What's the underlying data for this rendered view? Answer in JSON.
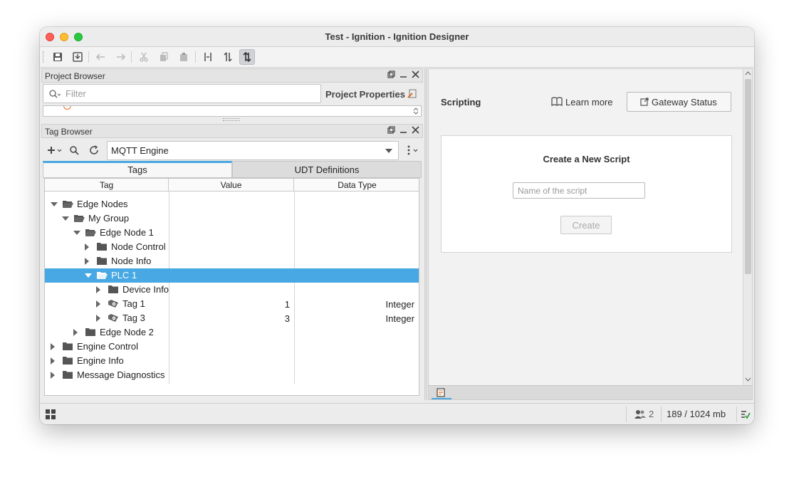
{
  "window": {
    "title": "Test - Ignition - Ignition Designer"
  },
  "project_browser": {
    "title": "Project Browser",
    "filter_placeholder": "Filter",
    "properties_label": "Project Properties"
  },
  "tag_browser": {
    "title": "Tag Browser",
    "provider": "MQTT Engine",
    "tabs": [
      "Tags",
      "UDT Definitions"
    ],
    "columns": [
      "Tag",
      "Value",
      "Data Type"
    ],
    "rows": [
      {
        "label": "Edge Nodes",
        "value": "",
        "type": ""
      },
      {
        "label": "My Group",
        "value": "",
        "type": ""
      },
      {
        "label": "Edge Node 1",
        "value": "",
        "type": ""
      },
      {
        "label": "Node Control",
        "value": "",
        "type": ""
      },
      {
        "label": "Node Info",
        "value": "",
        "type": ""
      },
      {
        "label": "PLC 1",
        "value": "",
        "type": ""
      },
      {
        "label": "Device Info",
        "value": "",
        "type": ""
      },
      {
        "label": "Tag 1",
        "value": "1",
        "type": "Integer"
      },
      {
        "label": "Tag 3",
        "value": "3",
        "type": "Integer"
      },
      {
        "label": "Edge Node 2",
        "value": "",
        "type": ""
      },
      {
        "label": "Engine Control",
        "value": "",
        "type": ""
      },
      {
        "label": "Engine Info",
        "value": "",
        "type": ""
      },
      {
        "label": "Message Diagnostics",
        "value": "",
        "type": ""
      }
    ]
  },
  "scripting": {
    "title": "Scripting",
    "learn_more": "Learn more",
    "gateway_status": "Gateway Status",
    "card_title": "Create a New Script",
    "name_placeholder": "Name of the script",
    "create_label": "Create"
  },
  "status": {
    "users": "2",
    "memory": "189 / 1024 mb"
  },
  "colors": {
    "selection": "#48a8e3",
    "accent_tab": "#49a6e1"
  }
}
